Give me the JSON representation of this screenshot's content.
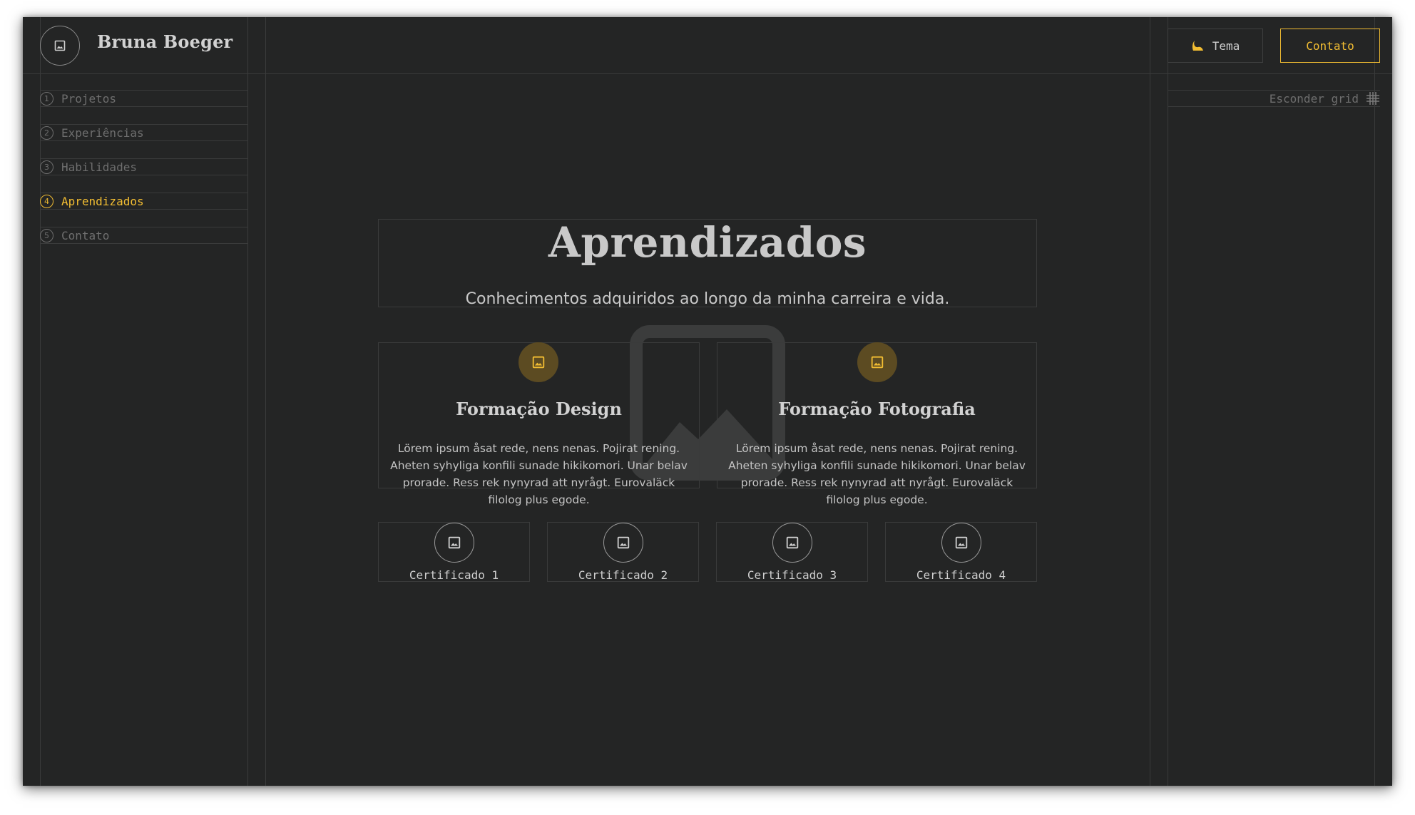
{
  "header": {
    "brand_name": "Bruna Boeger",
    "theme_button_label": "Tema",
    "contact_button_label": "Contato"
  },
  "sidebar": {
    "items": [
      {
        "number": "1",
        "label": "Projetos"
      },
      {
        "number": "2",
        "label": "Experiências"
      },
      {
        "number": "3",
        "label": "Habilidades"
      },
      {
        "number": "4",
        "label": "Aprendizados",
        "active": true
      },
      {
        "number": "5",
        "label": "Contato"
      }
    ]
  },
  "grid_toggle": {
    "label": "Esconder grid",
    "icon": "grid-icon"
  },
  "main": {
    "title": "Aprendizados",
    "subtitle": "Conhecimentos adquiridos ao longo da minha carreira e vida.",
    "cards": [
      {
        "title": "Formação Design",
        "text": "Lörem ipsum åsat rede, nens nenas. Pojirat rening. Aheten syhyliga konfili sunade hikikomori. Unar belav prorade. Ress rek nynyrad att nyrågt. Eurovaläck filolog plus egode.",
        "icon": "image-icon"
      },
      {
        "title": "Formação Fotografia",
        "text": "Lörem ipsum åsat rede, nens nenas. Pojirat rening. Aheten syhyliga konfili sunade hikikomori. Unar belav prorade. Ress rek nynyrad att nyrågt. Eurovaläck filolog plus egode.",
        "icon": "image-icon"
      }
    ],
    "certificates": [
      {
        "label": "Certificado 1"
      },
      {
        "label": "Certificado 2"
      },
      {
        "label": "Certificado 3"
      },
      {
        "label": "Certificado 4"
      }
    ]
  },
  "colors": {
    "background": "#242525",
    "accent": "#f2bd32",
    "grid_line": "#3a3b3b",
    "text": "#c9c9c9",
    "muted": "#6e6e6e"
  }
}
